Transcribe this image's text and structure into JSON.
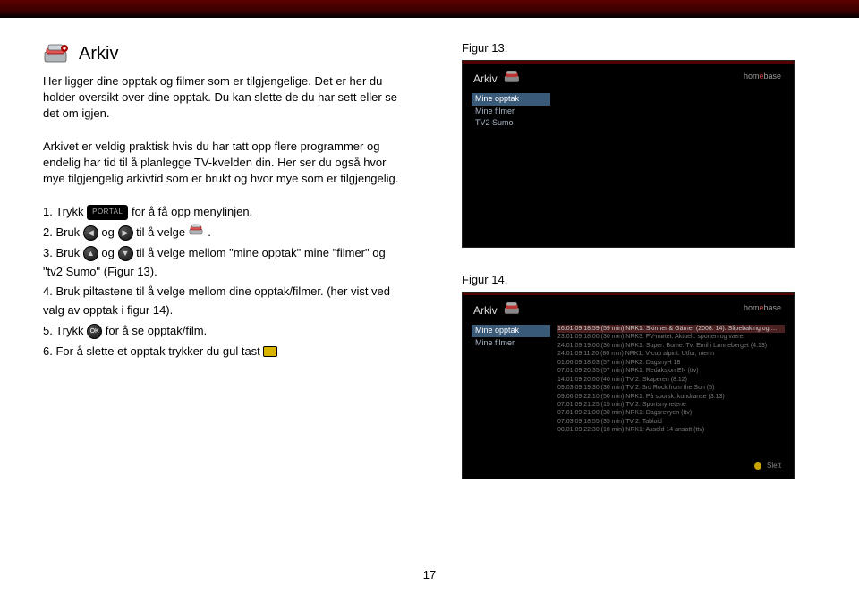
{
  "heading": "Arkiv",
  "para1": "Her ligger dine opptak og filmer som er tilgjengelige. Det er her du holder oversikt over dine opptak. Du kan slette de du har sett eller se det om igjen.",
  "para2": "Arkivet er veldig praktisk hvis du har tatt opp flere programmer og endelig har tid til å planlegge TV-kvelden din. Her ser du også hvor mye tilgjengelig arkivtid som er brukt og hvor mye som er tilgjengelig.",
  "steps": {
    "s1a": "1. Trykk ",
    "s1b": " for å få opp menylinjen.",
    "s2a": "2. Bruk ",
    "s2b": " og ",
    "s2c": " til å velge ",
    "s2d": ".",
    "s3a": "3. Bruk ",
    "s3b": " og ",
    "s3c": " til å velge mellom \"mine opptak\" mine \"filmer\" og \"tv2 Sumo\" (Figur 13).",
    "s4": "4. Bruk piltastene til å velge mellom dine opptak/filmer. (her vist  ved valg av opptak i figur 14).",
    "s5a": "5. Trykk ",
    "s5b": " for å se opptak/film.",
    "s6a": "6. For å slette et opptak trykker du gul tast "
  },
  "portal_label": "PORTAL",
  "ok_label": "OK",
  "fig13_label": "Figur 13.",
  "fig14_label": "Figur 14.",
  "tv": {
    "title": "Arkiv",
    "homebase_a": "hom",
    "homebase_e": "e",
    "homebase_b": "base",
    "menu": [
      "Mine opptak",
      "Mine filmer",
      "TV2 Sumo"
    ],
    "list": [
      "16.01.09 18:59 (59 min) NRK1: Skinner & Gärner (2008: 14): Slipebaking og …",
      "23.01.09 18:00 (30 min) NRK3: FV-møtet: Aktuelt: sporten og været",
      "24.01.09 19:00 (30 min) NRK1: Super: Bume: Tv: Emil i Lønneberget (4:13)",
      "24.01.09 11:20 (80 min) NRK1: V-cup alpint: Utfor, menn",
      "01.06.09 18:03 (57 min) NRK2: DagsnyH 18",
      "07.01.09 20:35 (57 min) NRK1: Redaksjon EN (ttv)",
      "14.01.09 20:00 (40 min) TV 2: Skaperen (8:12)",
      "09.03.09 19:30 (30 min) TV 2: 3rd Rock from the Sun (5)",
      "09.06.09 22:10 (50 min) NRK1: På sporsk: kundranse (3:13)",
      "07.01.09 21:25 (15 min) TV 2: Sportsnyhetene",
      "07.01.09 21:00 (30 min) NRK1: Dagsrevyen (ttv)",
      "07.03.09 18:55 (35 min) TV 2: Tabloid",
      "08.01.09 22:30 (10 min) NRK1: Assold 14 ansatt (ttv)"
    ],
    "slett": "Slett"
  },
  "page_number": "17"
}
